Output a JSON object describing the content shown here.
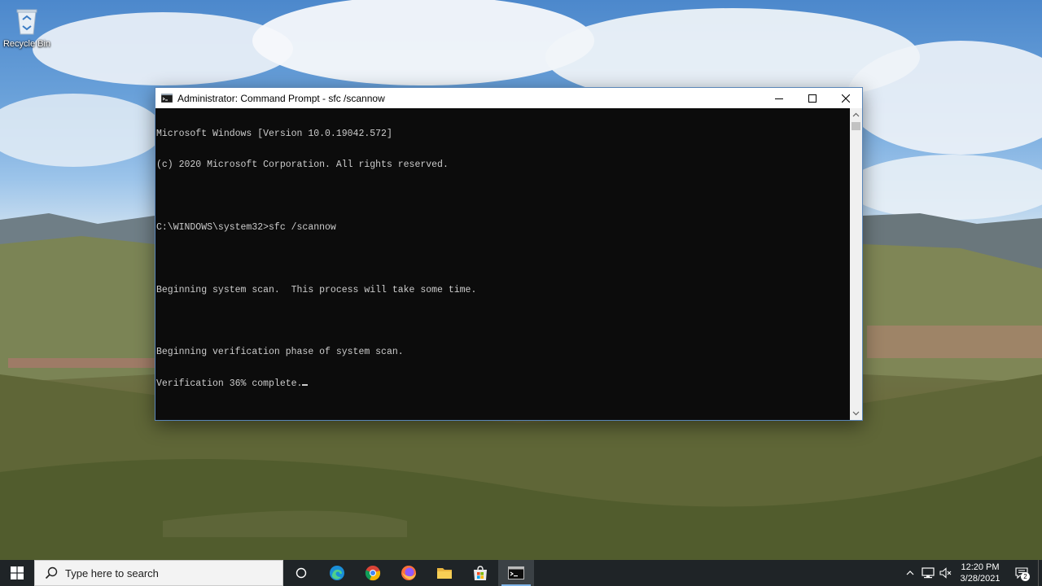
{
  "desktop": {
    "icons": [
      {
        "label": "Recycle Bin",
        "icon": "recycle-bin-icon"
      }
    ]
  },
  "window": {
    "title": "Administrator: Command Prompt - sfc  /scannow",
    "icon": "command-prompt-icon",
    "controls": [
      "minimize-icon",
      "maximize-icon",
      "close-icon"
    ]
  },
  "console": {
    "lines": [
      "Microsoft Windows [Version 10.0.19042.572]",
      "(c) 2020 Microsoft Corporation. All rights reserved.",
      "",
      "C:\\WINDOWS\\system32>sfc /scannow",
      "",
      "Beginning system scan.  This process will take some time.",
      "",
      "Beginning verification phase of system scan.",
      "Verification 36% complete."
    ],
    "background": "#0c0c0c",
    "foreground": "#cccccc"
  },
  "taskbar": {
    "search_placeholder": "Type here to search",
    "pinned": [
      {
        "name": "task-view",
        "icon": "task-view-icon"
      },
      {
        "name": "edge",
        "icon": "edge-icon"
      },
      {
        "name": "chrome",
        "icon": "chrome-icon"
      },
      {
        "name": "firefox",
        "icon": "firefox-icon"
      },
      {
        "name": "file-explorer",
        "icon": "folder-icon"
      },
      {
        "name": "microsoft-store",
        "icon": "store-icon"
      },
      {
        "name": "command-prompt",
        "icon": "command-prompt-icon",
        "active": true
      }
    ],
    "tray": {
      "time": "12:20 PM",
      "date": "3/28/2021",
      "notification_count": "2"
    }
  }
}
